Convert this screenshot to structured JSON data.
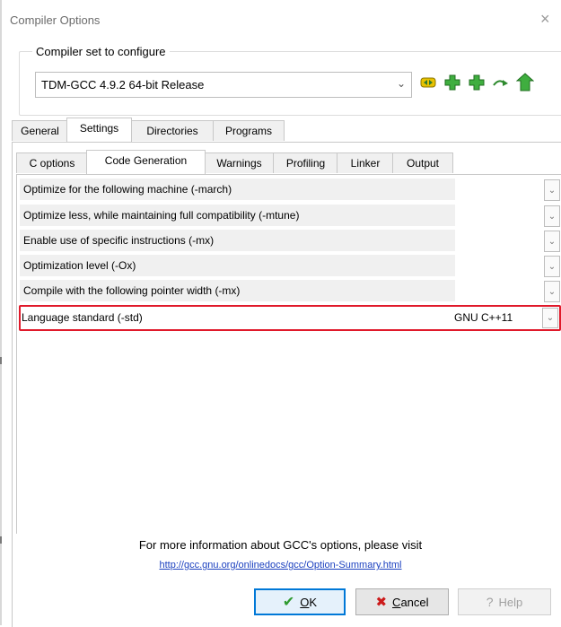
{
  "window": {
    "title": "Compiler Options",
    "close_symbol": "×"
  },
  "compiler_set": {
    "group_label": "Compiler set to configure",
    "selected": "TDM-GCC 4.9.2 64-bit Release",
    "toolbar": [
      {
        "name": "duplicate-set-icon",
        "symbol": "⇆",
        "color": "#b8a400"
      },
      {
        "name": "add-set-icon",
        "symbol": "✚",
        "color": "#2e9a2e"
      },
      {
        "name": "add-set-folder-icon",
        "symbol": "✚",
        "color": "#2e9a2e"
      },
      {
        "name": "rename-set-icon",
        "symbol": "↝",
        "color": "#3a8a3a"
      },
      {
        "name": "delete-set-icon",
        "symbol": "⌂",
        "color": "#2e9a2e"
      }
    ]
  },
  "main_tabs": [
    {
      "label": "General"
    },
    {
      "label": "Settings"
    },
    {
      "label": "Directories"
    },
    {
      "label": "Programs"
    }
  ],
  "sub_tabs": [
    {
      "label": "C options"
    },
    {
      "label": "Code Generation"
    },
    {
      "label": "Warnings"
    },
    {
      "label": "Profiling"
    },
    {
      "label": "Linker"
    },
    {
      "label": "Output"
    }
  ],
  "options": [
    {
      "label": "Optimize for the following machine (-march)",
      "value": ""
    },
    {
      "label": "Optimize less, while maintaining full compatibility (-mtune)",
      "value": ""
    },
    {
      "label": "Enable use of specific instructions (-mx)",
      "value": ""
    },
    {
      "label": "Optimization level (-Ox)",
      "value": ""
    },
    {
      "label": "Compile with the following pointer width (-mx)",
      "value": ""
    },
    {
      "label": "Language standard (-std)",
      "value": "GNU C++11"
    }
  ],
  "footer": {
    "info": "For more information about GCC's options, please visit",
    "link": "http://gcc.gnu.org/onlinedocs/gcc/Option-Summary.html"
  },
  "buttons": {
    "ok": {
      "mnemonic": "O",
      "rest": "K",
      "icon": "✔"
    },
    "cancel": {
      "mnemonic": "C",
      "rest": "ancel",
      "icon": "✖"
    },
    "help": {
      "label": "Help",
      "icon": "?"
    }
  },
  "colors": {
    "highlight": "#e0192a",
    "ok_border": "#0078d7",
    "check": "#2e9a2e",
    "cross": "#cc1a1a"
  }
}
